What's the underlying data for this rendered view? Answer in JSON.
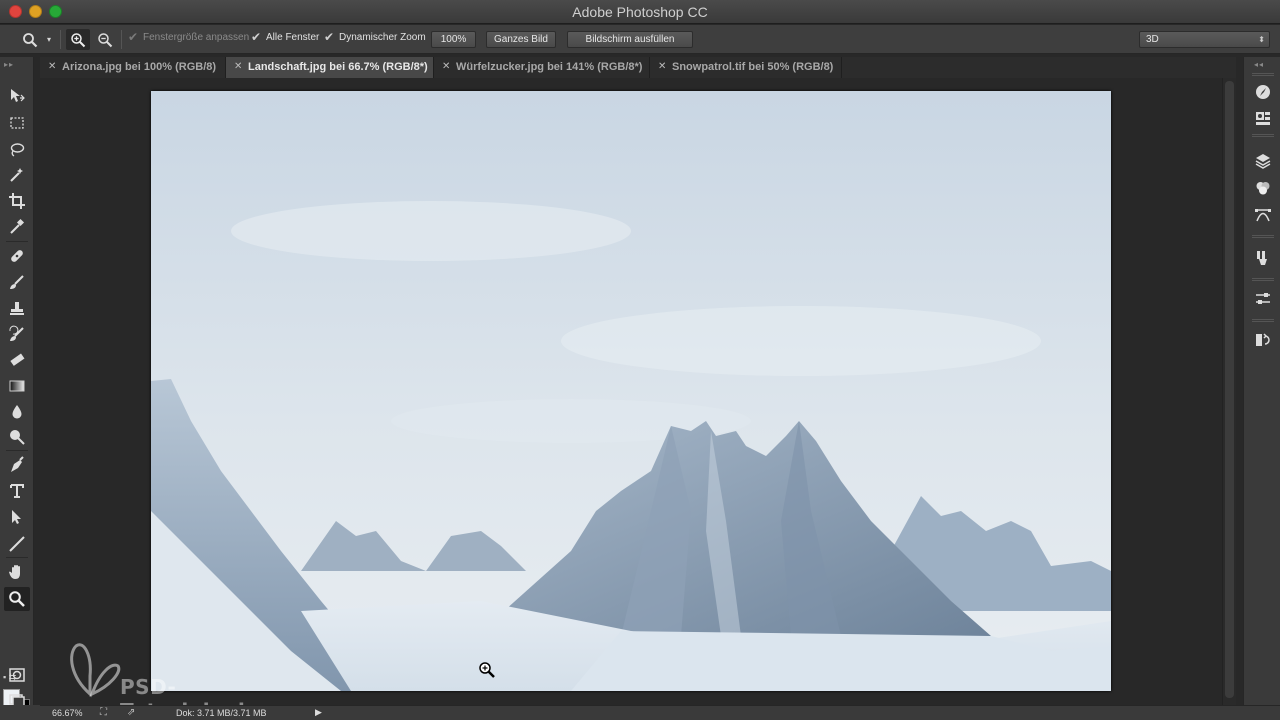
{
  "window": {
    "title": "Adobe Photoshop CC"
  },
  "options_bar": {
    "tool_icon": "zoom-tool-icon",
    "zoom_in_icon": "zoom-in-icon",
    "zoom_out_icon": "zoom-out-icon",
    "checkboxes": [
      {
        "label": "Fenstergröße anpassen",
        "checked": true,
        "enabled": false
      },
      {
        "label": "Alle Fenster",
        "checked": true,
        "enabled": true
      },
      {
        "label": "Dynamischer Zoom",
        "checked": true,
        "enabled": true
      }
    ],
    "buttons": [
      {
        "label": "100%"
      },
      {
        "label": "Ganzes Bild"
      },
      {
        "label": "Bildschirm ausfüllen"
      }
    ],
    "workspace_select": "3D"
  },
  "tabs": [
    {
      "label": "Arizona.jpg bei 100% (RGB/8)",
      "active": false
    },
    {
      "label": "Landschaft.jpg bei 66.7% (RGB/8*)",
      "active": true
    },
    {
      "label": "Würfelzucker.jpg bei 141% (RGB/8*)",
      "active": false
    },
    {
      "label": "Snowpatrol.tif bei 50% (RGB/8)",
      "active": false
    }
  ],
  "tools": [
    "move-tool-icon",
    "marquee-tool-icon",
    "lasso-tool-icon",
    "magic-wand-tool-icon",
    "crop-tool-icon",
    "eyedropper-tool-icon",
    "healing-brush-tool-icon",
    "brush-tool-icon",
    "clone-stamp-tool-icon",
    "history-brush-tool-icon",
    "eraser-tool-icon",
    "gradient-tool-icon",
    "blur-tool-icon",
    "dodge-tool-icon",
    "pen-tool-icon",
    "type-tool-icon",
    "path-selection-tool-icon",
    "line-tool-icon",
    "hand-tool-icon",
    "zoom-tool-icon"
  ],
  "colors": {
    "foreground": "#eef2f6",
    "background": "#000000",
    "ui_dark": "#282828",
    "ui_panel": "#3a3a3a"
  },
  "right_dock": [
    "navigator-icon",
    "info-icon",
    "layers-icon",
    "channels-icon",
    "paths-icon",
    "brush-presets-icon",
    "adjustments-icon",
    "history-icon"
  ],
  "watermark": {
    "text": "PSD-Tutorials.de"
  },
  "status": {
    "zoom": "66.67%",
    "doc": "Dok: 3.71 MB/3.71 MB"
  }
}
